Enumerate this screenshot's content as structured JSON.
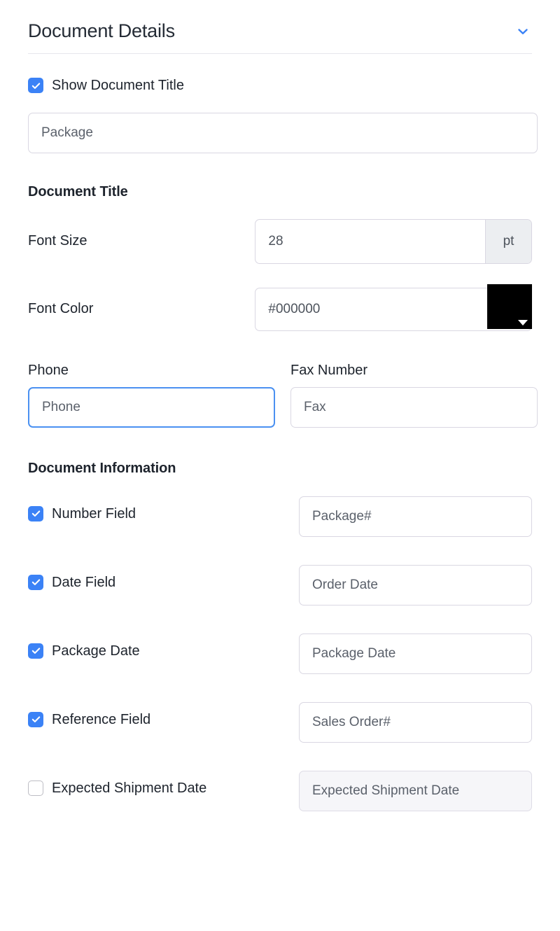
{
  "header": {
    "title": "Document Details",
    "collapse_icon": "chevron-down-icon",
    "accent_color": "#3b82f6"
  },
  "show_document_title": {
    "label": "Show Document Title",
    "checked": true,
    "input_placeholder": "Package",
    "input_value": ""
  },
  "document_title_section": {
    "heading": "Document Title",
    "font_size": {
      "label": "Font Size",
      "value": "28",
      "suffix": "pt"
    },
    "font_color": {
      "label": "Font Color",
      "value": "#000000",
      "swatch_color": "#000000"
    }
  },
  "contact": {
    "phone": {
      "label": "Phone",
      "placeholder": "Phone",
      "value": "",
      "focused": true
    },
    "fax": {
      "label": "Fax Number",
      "placeholder": "Fax",
      "value": "",
      "focused": false
    }
  },
  "document_information": {
    "heading": "Document Information",
    "rows": [
      {
        "label": "Number Field",
        "checked": true,
        "placeholder": "Package#",
        "disabled": false
      },
      {
        "label": "Date Field",
        "checked": true,
        "placeholder": "Order Date",
        "disabled": false
      },
      {
        "label": "Package Date",
        "checked": true,
        "placeholder": "Package Date",
        "disabled": false
      },
      {
        "label": "Reference Field",
        "checked": true,
        "placeholder": "Sales Order#",
        "disabled": false
      },
      {
        "label": "Expected Shipment Date",
        "checked": false,
        "placeholder": "Expected Shipment Date",
        "disabled": true
      }
    ]
  }
}
